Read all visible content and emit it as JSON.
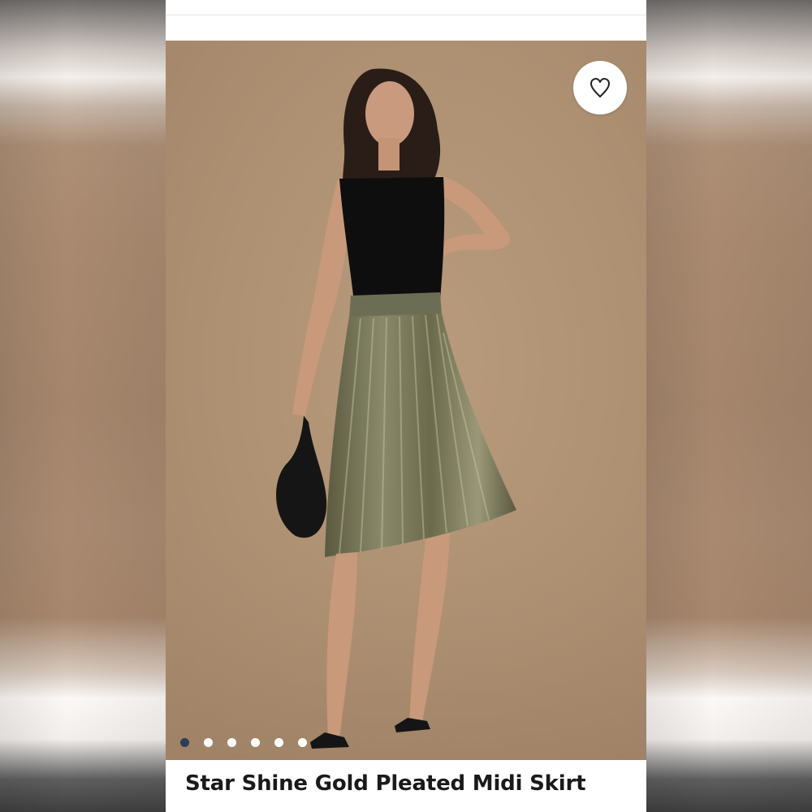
{
  "product": {
    "title": "Star Shine Gold Pleated Midi Skirt"
  },
  "gallery": {
    "slide_count": 6,
    "active_index": 0
  },
  "favorite": {
    "icon": "heart-outline-icon",
    "favorited": false
  },
  "colors": {
    "backdrop": "#a98a70",
    "active_dot": "#2d3e57",
    "inactive_dot": "#ffffff",
    "title_text": "#1a1a1a"
  }
}
